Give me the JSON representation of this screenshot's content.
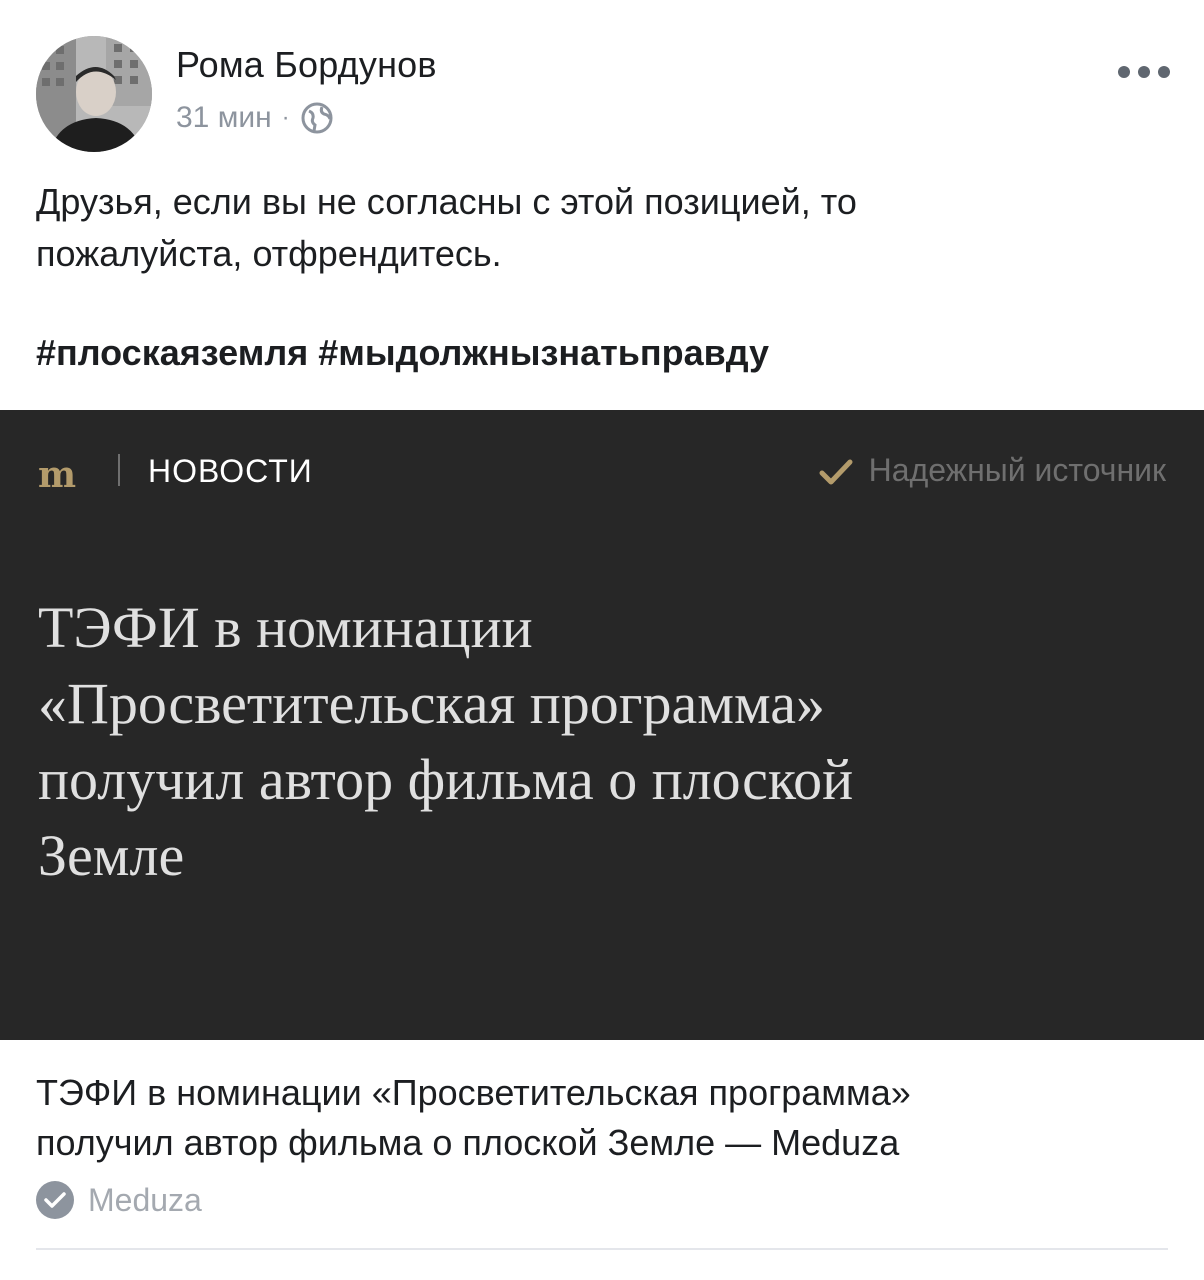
{
  "post": {
    "author": "Рома Бордунов",
    "time": "31 мин",
    "separator": "·",
    "privacy_icon": "globe-icon",
    "more_icon": "more-dots-icon",
    "text_line1": "Друзья, если вы не согласны с этой позицией, то",
    "text_line2": "пожалуйста, отфрендитесь.",
    "hashtags": "#плоскаяземля #мыдолжнызнатьправду"
  },
  "preview": {
    "logo": "m",
    "section": "НОВОСТИ",
    "trust_label": "Надежный источник",
    "headline_line1": "ТЭФИ в номинации",
    "headline_line2": "«Просветительская программа»",
    "headline_line3": "получил автор фильма о плоской",
    "headline_line4": "Земле",
    "colors": {
      "background": "#272727",
      "logo": "#b39b6b",
      "headline": "#e0e0e0",
      "muted": "#6f6f6f"
    }
  },
  "link": {
    "title_line1": "ТЭФИ в номинации «Просветительская программа»",
    "title_line2": "получил автор фильма о плоской Земле — Meduza",
    "source": "Meduza",
    "source_icon": "verified-check-icon"
  }
}
